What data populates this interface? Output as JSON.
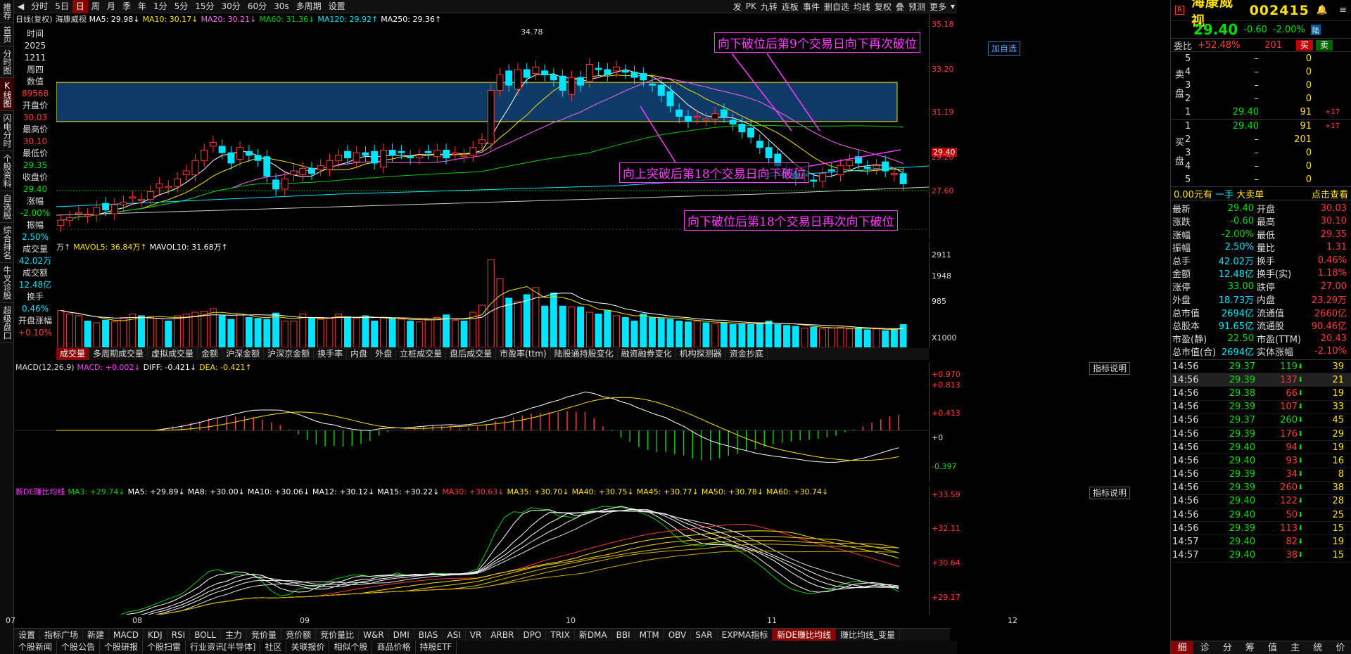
{
  "left_nav": [
    "推荐",
    "首页",
    "分时图",
    "K线图",
    "闪电分时",
    "个股资料",
    "自选股",
    "综合排名",
    "牛叉诊股",
    "超级盘口"
  ],
  "left_nav_active": 3,
  "toolbar": {
    "items": [
      "分时",
      "5日",
      "日",
      "周",
      "月",
      "季",
      "年",
      "1分",
      "5分",
      "15分",
      "30分",
      "60分",
      "30s",
      "多周期",
      "设置"
    ],
    "active": 2,
    "right_items": [
      "发",
      "PK",
      "九转",
      "连板",
      "事件",
      "删自选",
      "均线",
      "复权",
      "叠",
      "预测",
      "更多"
    ]
  },
  "legend": {
    "name": "日线(复权)",
    "stock": "海康威视",
    "ma5": "MA5: 29.98↓",
    "ma10": "MA10: 30.17↓",
    "ma20": "MA20: 30.21↓",
    "ma60": "MA60: 31.36↓",
    "ma120": "MA120: 29.92↑",
    "ma250": "MA250: 29.36↑"
  },
  "info_column": [
    {
      "label": "时间",
      "value": "2025"
    },
    {
      "label": "",
      "value": "1211"
    },
    {
      "label": "",
      "value": "周四"
    },
    {
      "label": "数值",
      "value": "89568"
    },
    {
      "label": "开盘价",
      "value": "30.03"
    },
    {
      "label": "最高价",
      "value": "30.10"
    },
    {
      "label": "最低价",
      "value": "29.35"
    },
    {
      "label": "收盘价",
      "value": "29.40"
    },
    {
      "label": "涨幅",
      "value": "-2.00%"
    },
    {
      "label": "振幅",
      "value": "2.50%"
    },
    {
      "label": "成交量",
      "value": "42.02万"
    },
    {
      "label": "成交额",
      "value": "12.48亿"
    },
    {
      "label": "换手",
      "value": "0.46%"
    },
    {
      "label": "开盘涨幅",
      "value": "+0.10%"
    }
  ],
  "price_axis": [
    "35.18",
    "33.20",
    "31.19",
    "29.40",
    "29.20",
    "27.60"
  ],
  "annotations": {
    "high_label": "34.78",
    "add_watch": "加自选",
    "a1": "向下破位后第9个交易日向下再次破位",
    "a2": "向上突破后第18个交易日向下破位",
    "a3": "向下破位后第18个交易日再次向下破位"
  },
  "volume": {
    "legend_prefix": "万↑",
    "mavol5": "MAVOL5: 36.84万↑",
    "mavol10": "MAVOL10: 31.68万↑",
    "axis": [
      "2911",
      "1948",
      "985",
      "X1000"
    ]
  },
  "vol_tabs": [
    "成交量",
    "多周期成交量",
    "虚拟成交量",
    "金额",
    "沪深金额",
    "沪深京金额",
    "换手率",
    "内盘",
    "外盘",
    "立桩成交量",
    "盘后成交量",
    "市盈率(ttm)",
    "陆股通持股变化",
    "融资融券变化",
    "机构探测器",
    "资金抄底"
  ],
  "macd": {
    "title": "MACD(12,26,9)",
    "macd": "MACD: +0.002↓",
    "diff": "DIFF: -0.421↓",
    "dea": "DEA: -0.421↑",
    "help": "指标说明",
    "axis": [
      "+0.970",
      "+0.813",
      "+0.413",
      "+0",
      "-0.397"
    ]
  },
  "deb": {
    "title": "新DE赚比均线",
    "items": [
      "MA3: +29.74↓",
      "MA5: +29.89↓",
      "MA8: +30.00↓",
      "MA10: +30.06↓",
      "MA12: +30.12↓",
      "MA15: +30.22↓",
      "MA30: +30.63↓",
      "MA35: +30.70↓",
      "MA40: +30.75↓",
      "MA45: +30.77↓",
      "MA50: +30.78↓",
      "MA60: +30.74↓"
    ],
    "help": "指标说明",
    "axis": [
      "+33.59",
      "+32.11",
      "+30.64",
      "+29.17"
    ]
  },
  "date_axis": [
    "07",
    "08",
    "09",
    "10",
    "11",
    "12"
  ],
  "bottom_tabs": [
    "设置",
    "指标广场",
    "新建",
    "MACD",
    "KDJ",
    "RSI",
    "BOLL",
    "主力",
    "竞价量",
    "竞价额",
    "竞价量比",
    "W&R",
    "DMI",
    "BIAS",
    "ASI",
    "VR",
    "ARBR",
    "DPO",
    "TRIX",
    "新DMA",
    "BBI",
    "MTM",
    "OBV",
    "SAR",
    "EXPMA指标",
    "新DE赚比均线",
    "赚比均线_变量"
  ],
  "bottom_active": 25,
  "footer_tabs": [
    "个股新闻",
    "个股公告",
    "个股研报",
    "个股扫雷",
    "行业资讯[半导体]",
    "社区",
    "关联报价",
    "相似个股",
    "商品价格",
    "持股ETF"
  ],
  "quote": {
    "name": "海康威视",
    "code": "002415",
    "price": "29.40",
    "change": "-0.60",
    "pct": "-2.00%",
    "wei_bi_label": "委比",
    "wei_bi": "+52.48%",
    "wei_cha": "201",
    "buy_btn": "买",
    "sell_btn": "卖",
    "sell_side": "卖盘",
    "buy_side": "买盘",
    "asks": [
      {
        "lvl": "5",
        "price": "–",
        "vol": "0",
        "chg": ""
      },
      {
        "lvl": "4",
        "price": "–",
        "vol": "0",
        "chg": ""
      },
      {
        "lvl": "3",
        "price": "–",
        "vol": "0",
        "chg": ""
      },
      {
        "lvl": "2",
        "price": "–",
        "vol": "0",
        "chg": ""
      },
      {
        "lvl": "1",
        "price": "29.40",
        "vol": "91",
        "chg": "+17"
      }
    ],
    "bids": [
      {
        "lvl": "1",
        "price": "29.40",
        "vol": "91",
        "chg": "+17"
      },
      {
        "lvl": "2",
        "price": "–",
        "vol": "201",
        "chg": ""
      },
      {
        "lvl": "3",
        "price": "–",
        "vol": "0",
        "chg": ""
      },
      {
        "lvl": "4",
        "price": "–",
        "vol": "0",
        "chg": ""
      },
      {
        "lvl": "5",
        "price": "–",
        "vol": "0",
        "chg": ""
      }
    ],
    "unit_left": "0.00元有",
    "unit_mid": "一手",
    "unit_mid2": "大卖单",
    "unit_right": "点击查看",
    "stats": [
      [
        "最新",
        "29.40",
        "开盘",
        "30.03"
      ],
      [
        "涨跌",
        "-0.60",
        "最高",
        "30.10"
      ],
      [
        "涨幅",
        "-2.00%",
        "最低",
        "29.35"
      ],
      [
        "振幅",
        "2.50%",
        "量比",
        "1.31"
      ],
      [
        "总手",
        "42.02万",
        "换手",
        "0.46%"
      ],
      [
        "金额",
        "12.48亿",
        "换手(实)",
        "1.18%"
      ],
      [
        "涨停",
        "33.00",
        "跌停",
        "27.00"
      ],
      [
        "外盘",
        "18.73万",
        "内盘",
        "23.29万"
      ],
      [
        "总市值",
        "2694亿",
        "流通值",
        "2660亿"
      ],
      [
        "总股本",
        "91.65亿",
        "流通股",
        "90.46亿"
      ],
      [
        "市盈(静)",
        "22.50",
        "市盈(TTM)",
        "20.43"
      ],
      [
        "总市值(合)",
        "2694亿",
        "实体涨幅",
        "-2.10%"
      ]
    ],
    "ticks": [
      [
        "14:56",
        "29.37",
        "119",
        "39"
      ],
      [
        "14:56",
        "29.39",
        "137",
        "21"
      ],
      [
        "14:56",
        "29.38",
        "66",
        "19"
      ],
      [
        "14:56",
        "29.39",
        "107",
        "33"
      ],
      [
        "14:56",
        "29.37",
        "260",
        "45"
      ],
      [
        "14:56",
        "29.39",
        "176",
        "29"
      ],
      [
        "14:56",
        "29.40",
        "94",
        "19"
      ],
      [
        "14:56",
        "29.40",
        "93",
        "16"
      ],
      [
        "14:56",
        "29.39",
        "34",
        "8"
      ],
      [
        "14:56",
        "29.39",
        "260",
        "38"
      ],
      [
        "14:56",
        "29.40",
        "122",
        "28"
      ],
      [
        "14:56",
        "29.40",
        "50",
        "25"
      ],
      [
        "14:56",
        "29.39",
        "113",
        "15"
      ],
      [
        "14:57",
        "29.40",
        "82",
        "19"
      ],
      [
        "14:57",
        "29.40",
        "38",
        "15"
      ]
    ],
    "bottom_tabs": [
      "细",
      "诊",
      "分",
      "筹",
      "值",
      "主",
      "统",
      "价"
    ]
  },
  "chart_data": {
    "type": "candlestick",
    "series_close": [
      28.0,
      28.1,
      28.3,
      28.2,
      28.5,
      28.4,
      28.6,
      28.7,
      28.9,
      28.8,
      29.1,
      29.4,
      29.3,
      29.6,
      29.9,
      30.3,
      30.7,
      31.0,
      30.6,
      30.2,
      30.8,
      30.5,
      30.3,
      29.7,
      29.2,
      29.6,
      29.9,
      30.0,
      29.8,
      30.1,
      30.3,
      30.5,
      30.4,
      30.6,
      30.5,
      30.2,
      30.7,
      30.5,
      30.6,
      30.4,
      30.5,
      30.6,
      30.7,
      30.4,
      30.6,
      30.5,
      30.8,
      31.1,
      33.0,
      33.6,
      33.2,
      33.8,
      33.5,
      33.9,
      33.6,
      33.4,
      33.0,
      33.5,
      33.2,
      34.0,
      33.8,
      33.6,
      33.9,
      33.7,
      33.5,
      33.4,
      33.2,
      32.8,
      32.4,
      32.0,
      31.8,
      32.0,
      31.9,
      32.1,
      32.0,
      31.7,
      31.4,
      31.2,
      30.8,
      30.4,
      30.1,
      29.8,
      29.6,
      29.7,
      29.5,
      29.8,
      29.9,
      30.1,
      30.3,
      30.2,
      30.0,
      30.1,
      29.9,
      29.8,
      29.4
    ],
    "volume": [
      420,
      380,
      360,
      300,
      280,
      310,
      290,
      340,
      380,
      360,
      350,
      330,
      300,
      360,
      380,
      400,
      410,
      440,
      360,
      320,
      380,
      340,
      330,
      320,
      390,
      300,
      300,
      380,
      340,
      320,
      330,
      380,
      350,
      330,
      360,
      300,
      340,
      330,
      320,
      300,
      290,
      320,
      340,
      370,
      310,
      300,
      400,
      480,
      1000,
      780,
      560,
      520,
      600,
      680,
      470,
      620,
      470,
      460,
      460,
      400,
      380,
      420,
      360,
      340,
      300,
      380,
      340,
      330,
      320,
      300,
      290,
      300,
      280,
      270,
      280,
      260,
      270,
      260,
      280,
      300,
      260,
      250,
      240,
      220,
      230,
      210,
      220,
      230,
      210,
      220,
      200,
      210,
      190,
      200,
      260
    ],
    "ylim": [
      27.6,
      35.18
    ]
  }
}
